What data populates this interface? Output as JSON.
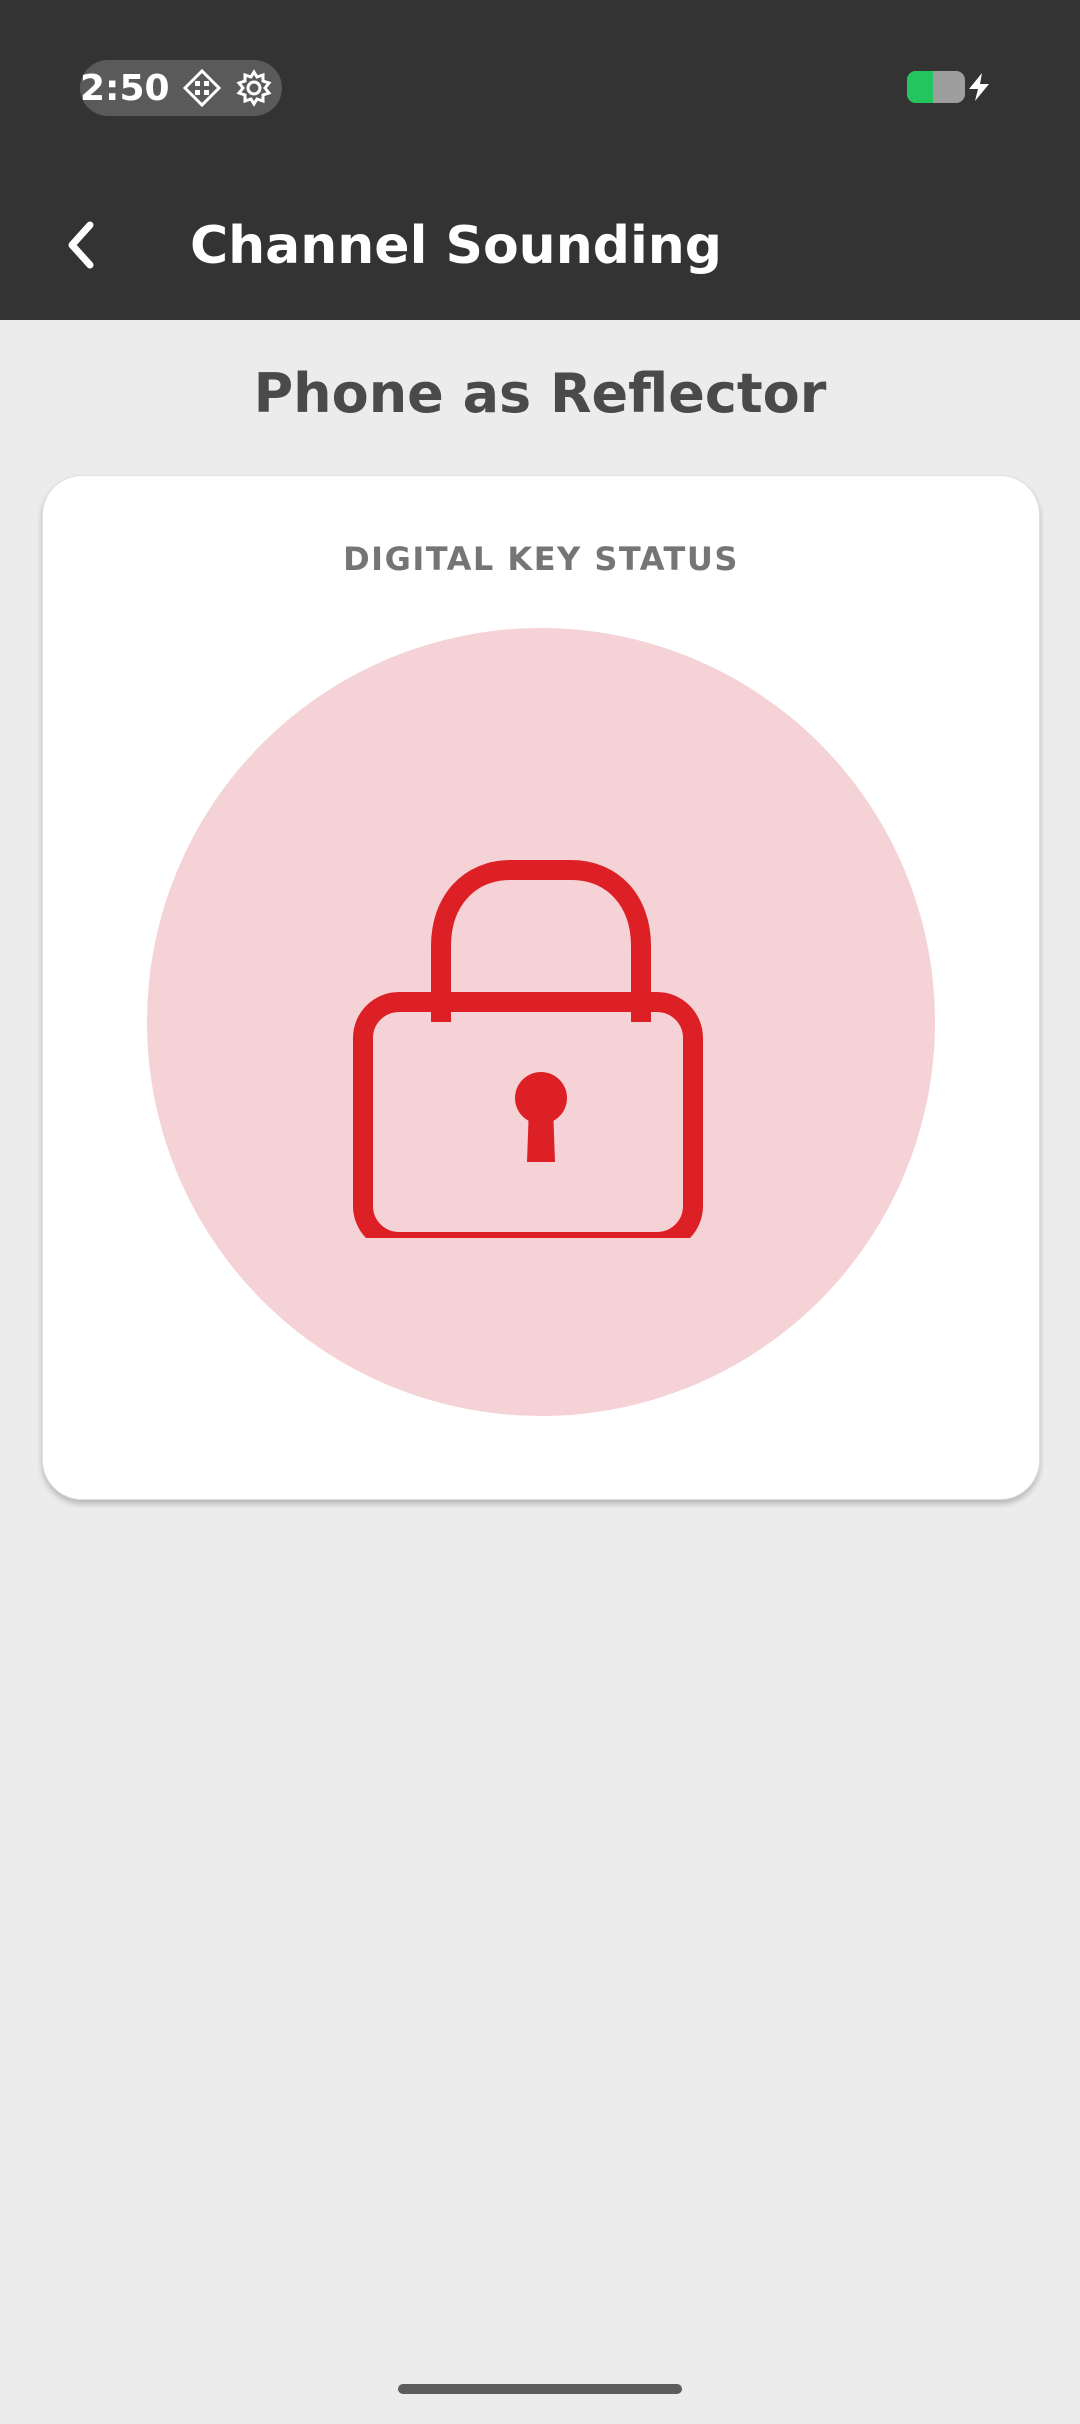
{
  "status_bar": {
    "time": "2:50",
    "icons": [
      "diamond-grid-icon",
      "gear-icon",
      "battery-charging-icon"
    ],
    "battery_color": "#22c55e"
  },
  "app_bar": {
    "title": "Channel Sounding",
    "back_icon": "chevron-left-icon"
  },
  "page": {
    "title": "Phone as Reflector"
  },
  "card": {
    "label": "DIGITAL KEY STATUS",
    "status_icon": "lock-closed-icon",
    "accent_color": "#dc2026",
    "circle_color": "#f5d2d5"
  }
}
